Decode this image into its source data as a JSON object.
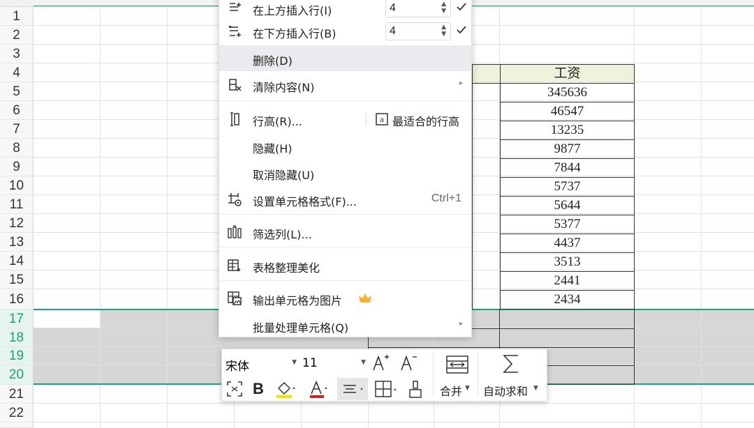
{
  "grid": {
    "row_numbers": [
      "1",
      "2",
      "3",
      "4",
      "5",
      "6",
      "7",
      "8",
      "9",
      "10",
      "11",
      "12",
      "13",
      "14",
      "15",
      "16",
      "17",
      "18",
      "19",
      "20",
      "21",
      "22"
    ],
    "selected_rows": [
      "17",
      "18",
      "19",
      "20"
    ],
    "accent_color": "#1aa36f"
  },
  "table": {
    "header": "工资",
    "values": [
      "345636",
      "46547",
      "13235",
      "9877",
      "7844",
      "5737",
      "5644",
      "5377",
      "4437",
      "3513",
      "2441",
      "2434"
    ]
  },
  "context_menu": {
    "insert_above": {
      "label": "在上方插入行(I)",
      "value": "4"
    },
    "insert_below": {
      "label": "在下方插入行(B)",
      "value": "4"
    },
    "delete": {
      "label": "删除(D)"
    },
    "clear": {
      "label": "清除内容(N)"
    },
    "row_height": {
      "label": "行高(R)...",
      "best_fit_label": "最适合的行高"
    },
    "hide": {
      "label": "隐藏(H)"
    },
    "unhide": {
      "label": "取消隐藏(U)"
    },
    "format_cells": {
      "label": "设置单元格格式(F)...",
      "shortcut": "Ctrl+1"
    },
    "filter_col": {
      "label": "筛选列(L)..."
    },
    "beautify": {
      "label": "表格整理美化"
    },
    "export_image": {
      "label": "输出单元格为图片"
    },
    "batch": {
      "label": "批量处理单元格(Q)"
    }
  },
  "mini_toolbar": {
    "font": "宋体",
    "size": "11",
    "merge_label": "合并",
    "autosum_label": "自动求和"
  }
}
